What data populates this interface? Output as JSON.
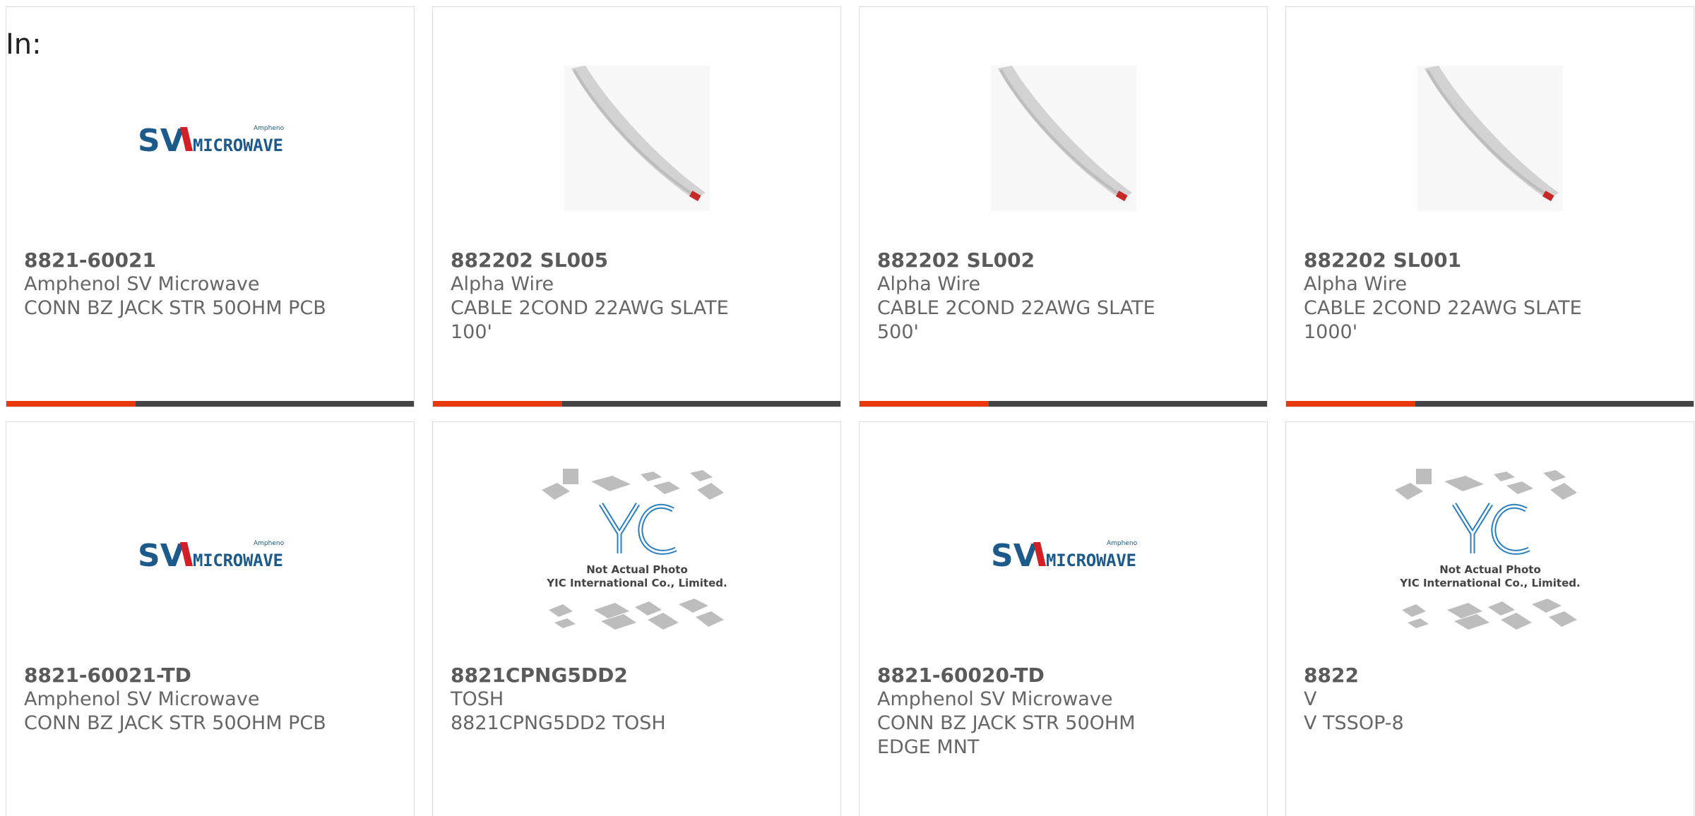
{
  "filter": {
    "label": "In:"
  },
  "products": [
    {
      "part": "8821-60021",
      "maker": "Amphenol SV Microwave",
      "desc": "CONN BZ JACK STR 50OHM PCB",
      "image": "sv-microwave-logo",
      "highlight_bar": true
    },
    {
      "part": "882202 SL005",
      "maker": "Alpha Wire",
      "desc": "CABLE 2COND 22AWG SLATE 100'",
      "image": "slate-cable-photo",
      "highlight_bar": true
    },
    {
      "part": "882202 SL002",
      "maker": "Alpha Wire",
      "desc": "CABLE 2COND 22AWG SLATE 500'",
      "image": "slate-cable-photo",
      "highlight_bar": true
    },
    {
      "part": "882202 SL001",
      "maker": "Alpha Wire",
      "desc": "CABLE 2COND 22AWG SLATE 1000'",
      "image": "slate-cable-photo",
      "highlight_bar": true
    },
    {
      "part": "8821-60021-TD",
      "maker": "Amphenol SV Microwave",
      "desc": "CONN BZ JACK STR 50OHM PCB",
      "image": "sv-microwave-logo"
    },
    {
      "part": "8821CPNG5DD2",
      "maker": "TOSH",
      "desc": "8821CPNG5DD2 TOSH",
      "image": "yic-placeholder",
      "placeholder_text": [
        "Not Actual Photo",
        "YIC International Co., Limited."
      ]
    },
    {
      "part": "8821-60020-TD",
      "maker": "Amphenol SV Microwave",
      "desc": "CONN BZ JACK STR 50OHM EDGE MNT",
      "image": "sv-microwave-logo"
    },
    {
      "part": "8822",
      "maker": "V",
      "desc": "V TSSOP-8",
      "image": "yic-placeholder",
      "placeholder_text": [
        "Not Actual Photo",
        "YIC International Co., Limited."
      ]
    }
  ],
  "logo": {
    "brand_sv": "SV",
    "brand_word": "MICROWAVE",
    "brand_small": "Amphenol"
  },
  "colors": {
    "accent": "#e8390e",
    "bar_dark": "#444444",
    "logo_blue": "#1c5a8c",
    "logo_red": "#d31f26",
    "yic_blue": "#2a7fc0"
  }
}
